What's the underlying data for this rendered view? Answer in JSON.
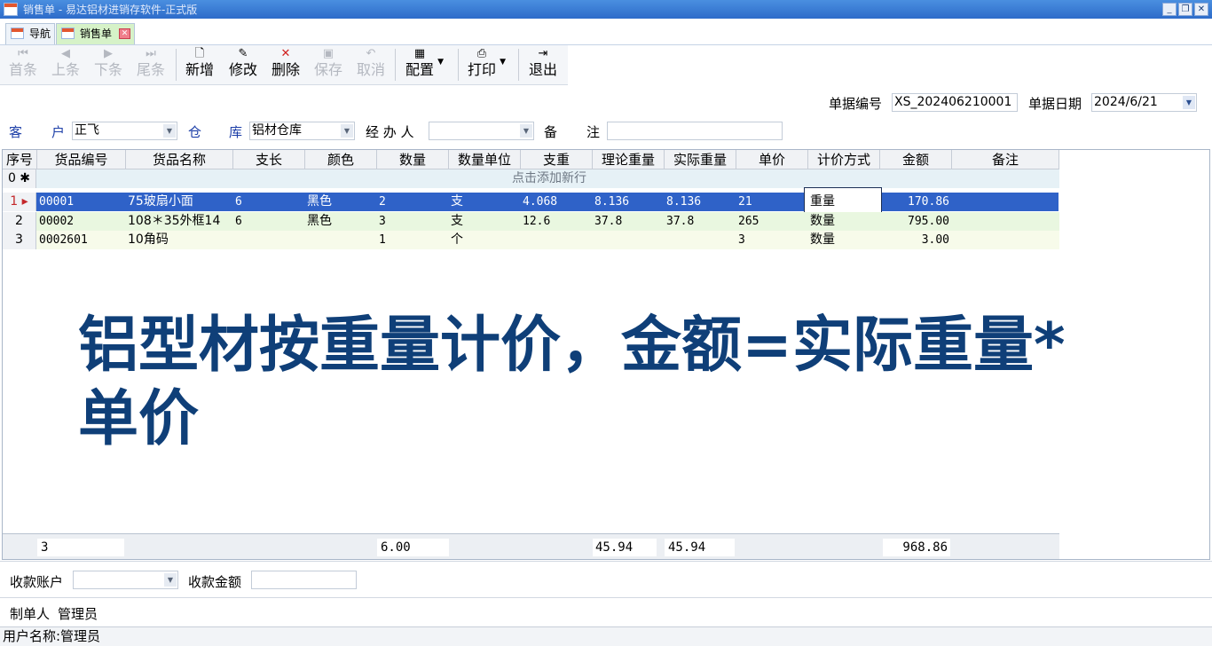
{
  "window": {
    "title": "销售单 - 易达铝材进销存软件-正式版",
    "controls": [
      "_",
      "❐",
      "✕"
    ]
  },
  "tabs": [
    {
      "label": "导航",
      "active": false
    },
    {
      "label": "销售单",
      "active": true
    }
  ],
  "toolbar": {
    "first": "首条",
    "prev": "上条",
    "next": "下条",
    "last": "尾条",
    "add": "新增",
    "edit": "修改",
    "delete": "删除",
    "save": "保存",
    "cancel": "取消",
    "config": "配置",
    "print": "打印",
    "exit": "退出"
  },
  "header": {
    "doc_no_label": "单据编号",
    "doc_no": "XS_202406210001",
    "doc_date_label": "单据日期",
    "doc_date": "2024/6/21",
    "customer_label_a": "客",
    "customer_label_b": "户",
    "customer": "正飞",
    "warehouse_label_a": "仓",
    "warehouse_label_b": "库",
    "warehouse": "铝材仓库",
    "handler_label": "经 办 人",
    "handler": "",
    "remark_label_a": "备",
    "remark_label_b": "注",
    "remark": ""
  },
  "grid": {
    "columns": [
      "序号",
      "货品编号",
      "货品名称",
      "支长",
      "颜色",
      "数量",
      "数量单位",
      "支重",
      "理论重量",
      "实际重量",
      "单价",
      "计价方式",
      "金额",
      "备注"
    ],
    "add_row_hint": "点击添加新行",
    "new_row_no": "0",
    "rows": [
      {
        "no": "1",
        "code": "00001",
        "name": "75玻扇小面",
        "length": "6",
        "color": "黑色",
        "qty": "2",
        "unit": "支",
        "unit_weight": "4.068",
        "theory_weight": "8.136",
        "actual_weight": "8.136",
        "price": "21",
        "pricing": "重量",
        "amount": "170.86",
        "remark": ""
      },
      {
        "no": "2",
        "code": "00002",
        "name": "108＊35外框14",
        "length": "6",
        "color": "黑色",
        "qty": "3",
        "unit": "支",
        "unit_weight": "12.6",
        "theory_weight": "37.8",
        "actual_weight": "37.8",
        "price": "265",
        "pricing": "数量",
        "amount": "795.00",
        "remark": ""
      },
      {
        "no": "3",
        "code": "0002601",
        "name": "10角码",
        "length": "",
        "color": "",
        "qty": "1",
        "unit": "个",
        "unit_weight": "",
        "theory_weight": "",
        "actual_weight": "",
        "price": "3",
        "pricing": "数量",
        "amount": "3.00",
        "remark": ""
      }
    ],
    "totals": {
      "count": "3",
      "qty": "6.00",
      "theory_weight": "45.94",
      "actual_weight": "45.94",
      "amount": "968.86"
    }
  },
  "overlay": {
    "line1": "铝型材按重量计价，金额=实际重量*",
    "line2": "单价"
  },
  "payment": {
    "account_label": "收款账户",
    "account": "",
    "amount_label": "收款金额",
    "amount": ""
  },
  "maker": {
    "label": "制单人",
    "name": "管理员"
  },
  "status": {
    "text": "用户名称:管理员"
  },
  "colors": {
    "selected_row": "#2f62c8",
    "titlebar": "#2d6bc9",
    "overlay_text": "#0f3f78",
    "active_tab": "#d6f2c8"
  }
}
